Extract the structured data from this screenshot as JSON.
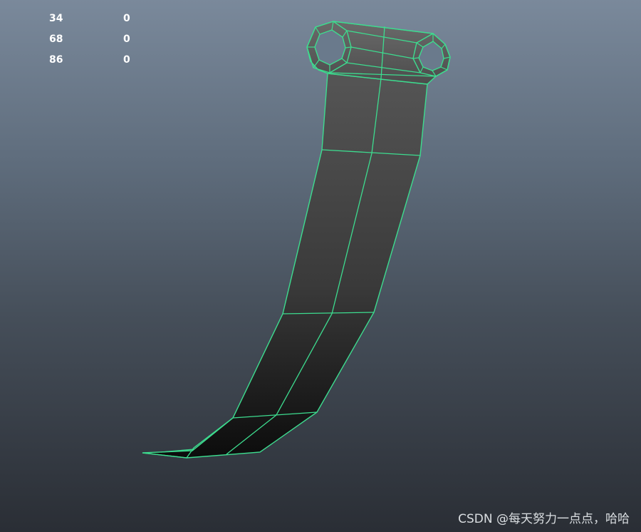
{
  "hud": {
    "rows": [
      {
        "a": "34",
        "b": "0"
      },
      {
        "a": "68",
        "b": "0"
      },
      {
        "a": "86",
        "b": "0"
      }
    ]
  },
  "watermark": "CSDN @每天努力一点点，哈哈",
  "colors": {
    "wire": "#3ddc8f",
    "bg_top": "#7a899b",
    "bg_bottom": "#2a2e35"
  }
}
